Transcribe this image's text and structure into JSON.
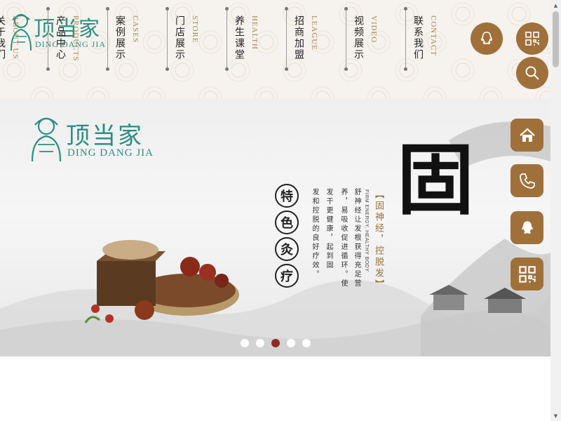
{
  "header": {
    "logo": {
      "cn": "顶当家",
      "en": "DING DANG JIA"
    },
    "nav": [
      {
        "cn": "关于我们",
        "en": "ABOUT US"
      },
      {
        "cn": "产品中心",
        "en": "PRODUCTS"
      },
      {
        "cn": "案例展示",
        "en": "CASES"
      },
      {
        "cn": "门店展示",
        "en": "STORE"
      },
      {
        "cn": "养生课堂",
        "en": "HEALTH"
      },
      {
        "cn": "招商加盟",
        "en": "LEAGUE"
      },
      {
        "cn": "视频展示",
        "en": "VIDEO"
      },
      {
        "cn": "联系我们",
        "en": "CONTACT"
      }
    ],
    "buttons": {
      "qq": "qq-icon",
      "qrcode": "qrcode-icon",
      "search": "search-icon"
    }
  },
  "banner": {
    "logo": {
      "cn": "顶当家",
      "en": "DING DANG JIA"
    },
    "big_char": "固",
    "badges": [
      "特",
      "色",
      "灸",
      "疗"
    ],
    "slogan": "【固神经，控脱发】",
    "slogan_en": "FIRM ENERGY, HEALTHY BODY",
    "desc_lines": [
      "舒神经让发根获得充足营",
      "养，易吸收促进循环。使",
      "发干更健康，起到固",
      "发和控脱的良好疗效。"
    ],
    "slides": 5,
    "active_slide": 3
  },
  "sidebar": [
    "home-icon",
    "phone-icon",
    "qq-icon",
    "qrcode-icon"
  ],
  "colors": {
    "accent": "#a0703a",
    "brand_teal": "#2a8f82",
    "active_dot": "#8e2b22"
  }
}
